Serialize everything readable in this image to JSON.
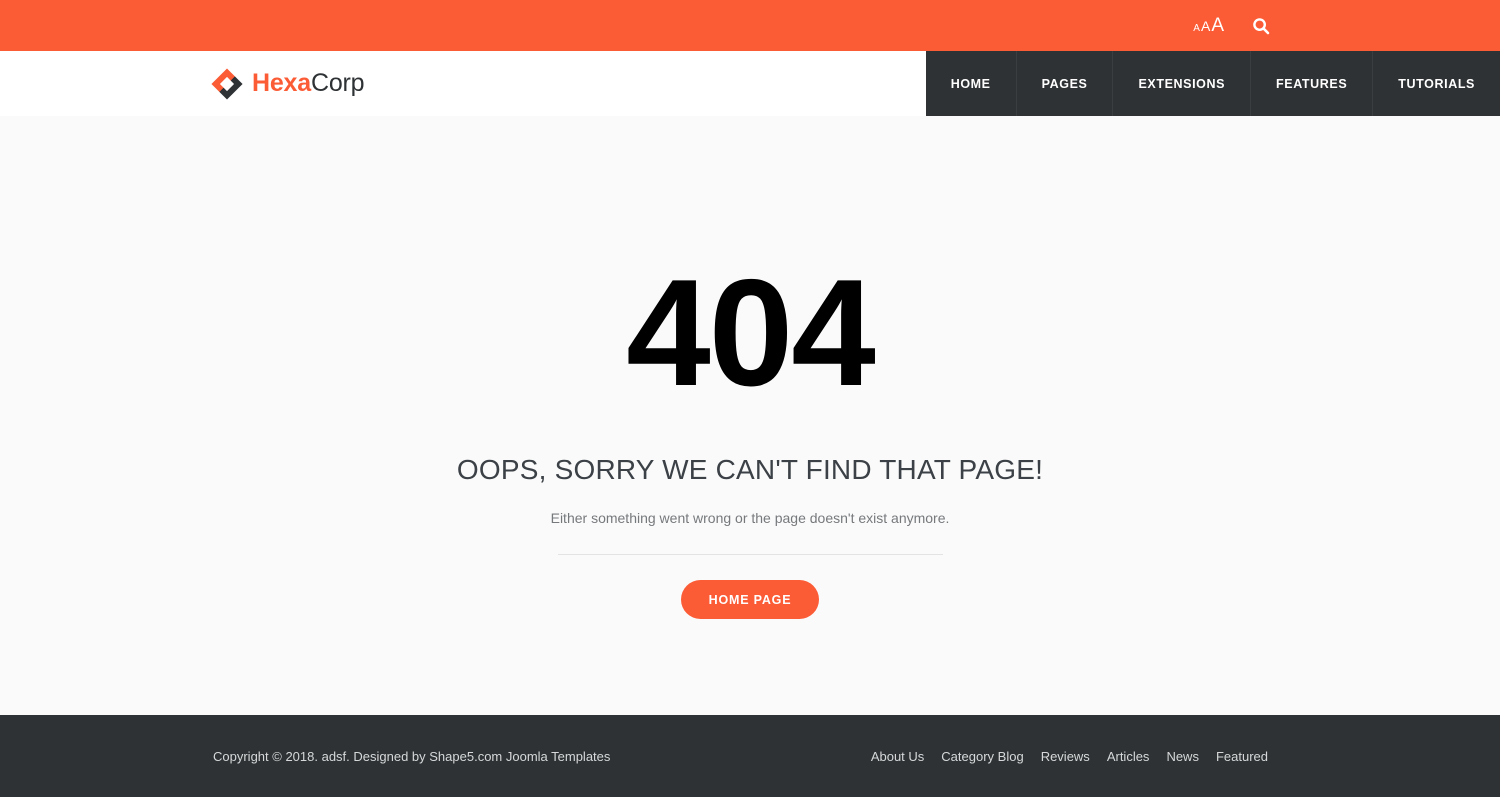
{
  "topbar": {
    "background_color": "#fb5b35",
    "font_sizer": {
      "small_label": "A",
      "medium_label": "A",
      "large_label": "A"
    },
    "search_icon_name": "search-icon"
  },
  "header": {
    "logo": {
      "name_primary": "Hexa",
      "name_secondary": "Corp",
      "primary_color": "#fb5b35",
      "secondary_color": "#2e3234"
    },
    "nav": {
      "background_color": "#2e3234",
      "items": [
        {
          "label": "HOME"
        },
        {
          "label": "PAGES"
        },
        {
          "label": "EXTENSIONS"
        },
        {
          "label": "FEATURES"
        },
        {
          "label": "TUTORIALS"
        }
      ]
    }
  },
  "main": {
    "error_code": "404",
    "error_title": "OOPS, SORRY WE CAN'T FIND THAT PAGE!",
    "error_subtitle": "Either something went wrong or the page doesn't exist anymore.",
    "home_button_label": "HOME PAGE",
    "accent_color": "#fb5b35"
  },
  "footer": {
    "background_color": "#2e3234",
    "copyright": "Copyright © 2018. adsf. Designed by Shape5.com Joomla Templates",
    "links": [
      {
        "label": "About Us"
      },
      {
        "label": "Category Blog"
      },
      {
        "label": "Reviews"
      },
      {
        "label": "Articles"
      },
      {
        "label": "News"
      },
      {
        "label": "Featured"
      }
    ]
  }
}
